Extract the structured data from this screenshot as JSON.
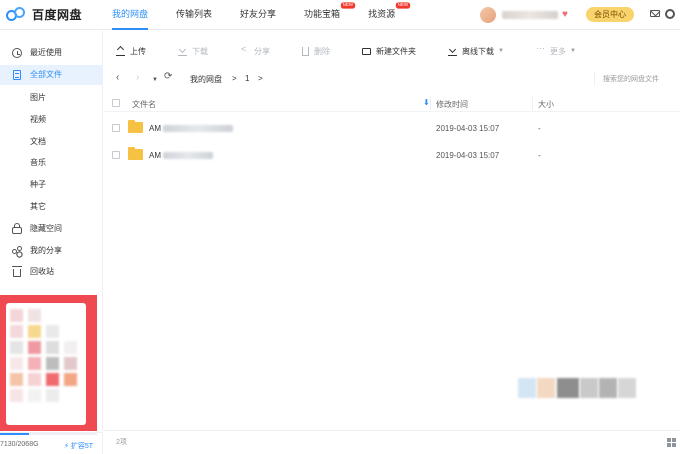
{
  "app": {
    "name": "百度网盘"
  },
  "nav": {
    "tabs": [
      {
        "label": "我的网盘",
        "active": true
      },
      {
        "label": "传输列表"
      },
      {
        "label": "好友分享"
      },
      {
        "label": "功能宝箱",
        "badge": "NEW"
      },
      {
        "label": "找资源",
        "badge": "NEW"
      }
    ]
  },
  "header": {
    "vip_label": "会员中心"
  },
  "sidebar": {
    "items": [
      {
        "label": "最近使用",
        "icon": "clock-icon"
      },
      {
        "label": "全部文件",
        "icon": "file-icon",
        "active": true
      },
      {
        "label": "图片"
      },
      {
        "label": "视频"
      },
      {
        "label": "文档"
      },
      {
        "label": "音乐"
      },
      {
        "label": "种子"
      },
      {
        "label": "其它"
      },
      {
        "label": "隐藏空间",
        "icon": "lock-icon"
      },
      {
        "label": "我的分享",
        "icon": "share-icon"
      },
      {
        "label": "回收站",
        "icon": "trash-icon"
      }
    ],
    "quota_text": "7130/2068G",
    "expand_label": "扩容5T",
    "quota_fraction": 0.3
  },
  "toolbar": {
    "upload": "上传",
    "download": "下载",
    "share": "分享",
    "delete": "删除",
    "new_folder": "新建文件夹",
    "offline_download": "离线下载",
    "more": "更多"
  },
  "path": {
    "crumbs": [
      "我的网盘",
      "1"
    ],
    "search_placeholder": "搜索您的网盘文件"
  },
  "table": {
    "headers": {
      "name": "文件名",
      "modified": "修改时间",
      "size": "大小"
    },
    "rows": [
      {
        "name_prefix": "AM",
        "modified": "2019-04-03 15:07",
        "size": "-"
      },
      {
        "name_prefix": "AM",
        "modified": "2019-04-03 15:07",
        "size": "-"
      }
    ]
  },
  "footer": {
    "count": "2项"
  },
  "colors": {
    "accent": "#2f8ef8",
    "folder": "#f5c244",
    "promo": "#ef4a52",
    "vip": "#f9d36b"
  }
}
